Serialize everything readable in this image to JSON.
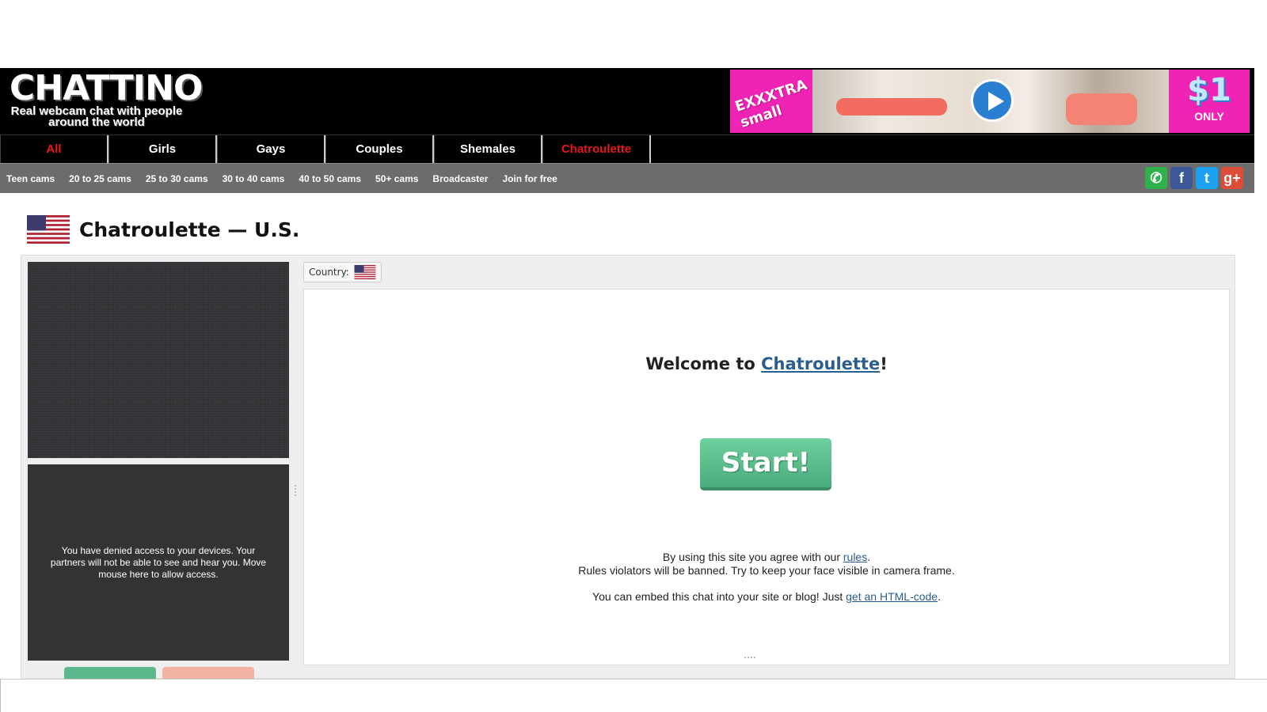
{
  "header": {
    "logo_title": "CHATTINO",
    "logo_tagline": "Real webcam chat with people around the world",
    "banner": {
      "left_text": "EXXXTRA small",
      "right_price": "$1",
      "right_caption": "ONLY"
    }
  },
  "main_nav": [
    {
      "label": "All",
      "color": "#e81818"
    },
    {
      "label": "Girls",
      "color": "#ffffff"
    },
    {
      "label": "Gays",
      "color": "#ffffff"
    },
    {
      "label": "Couples",
      "color": "#ffffff"
    },
    {
      "label": "Shemales",
      "color": "#ffffff"
    },
    {
      "label": "Chatroulette",
      "color": "#e81818"
    }
  ],
  "sub_nav": [
    "Teen cams",
    "20 to 25 cams",
    "25 to 30 cams",
    "30 to 40 cams",
    "40 to 50 cams",
    "50+ cams",
    "Broadcaster",
    "Join for free"
  ],
  "social": [
    {
      "icon": "whatsapp-icon",
      "glyph": "✆",
      "color": "#2fb24c"
    },
    {
      "icon": "facebook-icon",
      "glyph": "f",
      "color": "#3b5998"
    },
    {
      "icon": "twitter-icon",
      "glyph": "t",
      "color": "#1da1f2"
    },
    {
      "icon": "google-plus-icon",
      "glyph": "g+",
      "color": "#dd4b39"
    }
  ],
  "page": {
    "title": "Chatroulette — U.S."
  },
  "chat": {
    "country_label": "Country:",
    "device_notice": "You have denied access to your devices. Your partners will not be able to see and hear you. Move mouse here to allow access.",
    "welcome_prefix": "Welcome to ",
    "welcome_link": "Chatroulette",
    "welcome_suffix": "!",
    "start_label": "Start!",
    "rules_prefix": "By using this site you agree with our ",
    "rules_link": "rules",
    "rules_suffix": ".",
    "rules_line2": "Rules violators will be banned. Try to keep your face visible in camera frame.",
    "embed_prefix": "You can embed this chat into your site or blog! Just ",
    "embed_link": "get an HTML-code",
    "embed_suffix": "."
  },
  "colors": {
    "accent_red": "#e81818",
    "link_blue": "#2b5e8c",
    "start_green": "#5cb88c"
  }
}
